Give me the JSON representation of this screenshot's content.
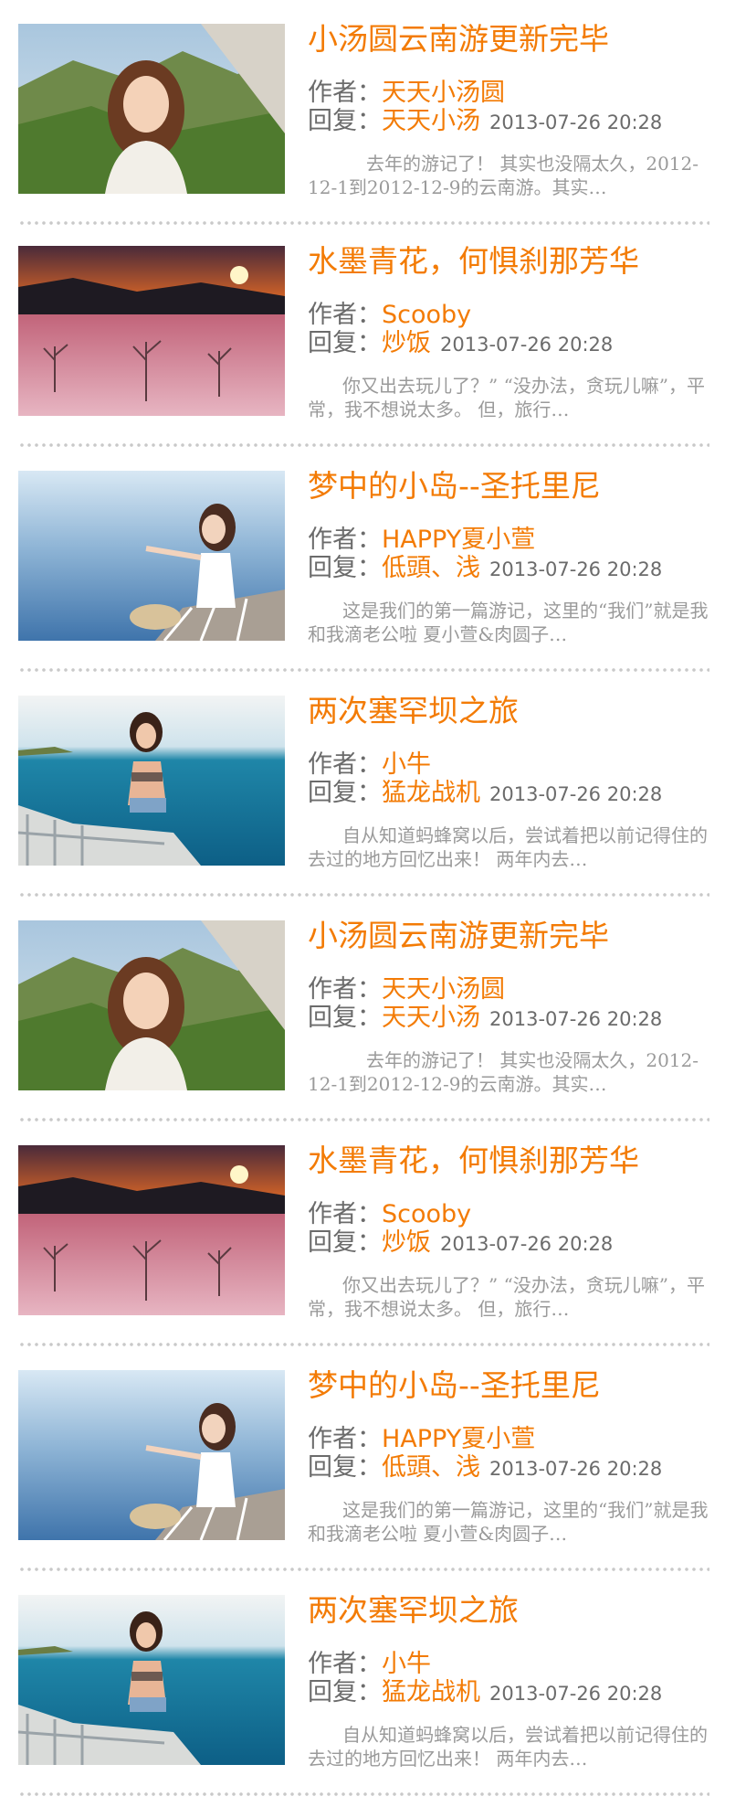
{
  "colors": {
    "accent": "#f37b05",
    "label": "#6b6b6b",
    "excerpt": "#9a9a9a",
    "dots": "#c9c9c9"
  },
  "labels": {
    "author": "作者：",
    "reply": "回复："
  },
  "posts": [
    {
      "image": "mountain-woman-photo",
      "title": "小汤圆云南游更新完毕",
      "author": "天天小汤圆",
      "reply_user": "天天小汤",
      "time": "2013-07-26 20:28",
      "excerpt": "去年的游记了！ 其实也没隔太久，2012-12-1到2012-12-9的云南游。其实…"
    },
    {
      "image": "sunset-snow-photo",
      "title": "水墨青花，何惧刹那芳华",
      "author": "Scooby",
      "reply_user": "炒饭",
      "time": "2013-07-26 20:28",
      "excerpt": "你又出去玩儿了？” “没办法，贪玩儿嘛”，平常，我不想说太多。 但，旅行…"
    },
    {
      "image": "island-pier-photo",
      "title": "梦中的小岛--圣托里尼",
      "author": "HAPPY夏小萱",
      "reply_user": "低頭、浅",
      "time": "2013-07-26 20:28",
      "excerpt": "这是我们的第一篇游记，这里的“我们”就是我和我滴老公啦 夏小萱&肉圆子…"
    },
    {
      "image": "sea-dock-photo",
      "title": "两次塞罕坝之旅",
      "author": "小牛",
      "reply_user": "猛龙战机",
      "time": "2013-07-26 20:28",
      "excerpt": "自从知道蚂蜂窝以后，尝试着把以前记得住的去过的地方回忆出来！ 两年内去…"
    },
    {
      "image": "mountain-woman-photo",
      "title": "小汤圆云南游更新完毕",
      "author": "天天小汤圆",
      "reply_user": "天天小汤",
      "time": "2013-07-26 20:28",
      "excerpt": "去年的游记了！ 其实也没隔太久，2012-12-1到2012-12-9的云南游。其实…"
    },
    {
      "image": "sunset-snow-photo",
      "title": "水墨青花，何惧刹那芳华",
      "author": "Scooby",
      "reply_user": "炒饭",
      "time": "2013-07-26 20:28",
      "excerpt": "你又出去玩儿了？” “没办法，贪玩儿嘛”，平常，我不想说太多。 但，旅行…"
    },
    {
      "image": "island-pier-photo",
      "title": "梦中的小岛--圣托里尼",
      "author": "HAPPY夏小萱",
      "reply_user": "低頭、浅",
      "time": "2013-07-26 20:28",
      "excerpt": "这是我们的第一篇游记，这里的“我们”就是我和我滴老公啦 夏小萱&肉圆子…"
    },
    {
      "image": "sea-dock-photo",
      "title": "两次塞罕坝之旅",
      "author": "小牛",
      "reply_user": "猛龙战机",
      "time": "2013-07-26 20:28",
      "excerpt": "自从知道蚂蜂窝以后，尝试着把以前记得住的去过的地方回忆出来！ 两年内去…"
    }
  ]
}
